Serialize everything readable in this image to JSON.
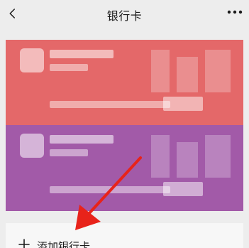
{
  "header": {
    "title": "银行卡",
    "back_icon": "chevron-left-icon",
    "more_icon": "more-dots-icon"
  },
  "cards": {
    "colors": {
      "card_1": "#E46869",
      "card_2": "#A25AA8"
    }
  },
  "add_card": {
    "label": "添加银行卡",
    "icon": "plus-icon"
  },
  "annotation": {
    "arrow_color": "#E8231A"
  }
}
